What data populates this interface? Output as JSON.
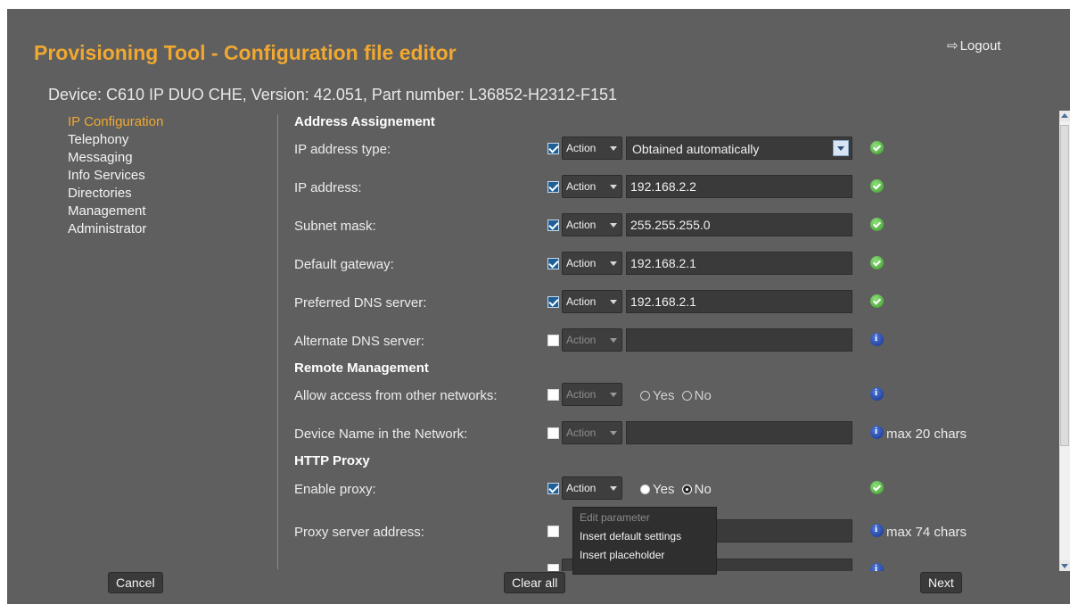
{
  "app": {
    "title": "Provisioning Tool - Configuration file editor",
    "logout_label": "Logout",
    "logout_icon": "arrow-right-icon"
  },
  "device": {
    "model": "Device: C610 IP DUO CHE,",
    "version": "Version: 42.051,",
    "part_number": "Part number: L36852-H2312-F151"
  },
  "nav": {
    "items": [
      {
        "label": "IP Configuration",
        "active": true
      },
      {
        "label": "Telephony",
        "active": false
      },
      {
        "label": "Messaging",
        "active": false
      },
      {
        "label": "Info Services",
        "active": false
      },
      {
        "label": "Directories",
        "active": false
      },
      {
        "label": "Management",
        "active": false
      },
      {
        "label": "Administrator",
        "active": false
      }
    ]
  },
  "sections": {
    "address": "Address Assignement",
    "remote": "Remote Management",
    "proxy": "HTTP Proxy"
  },
  "action_label": "Action",
  "rows": {
    "ip_type": {
      "label": "IP address type:",
      "value": "Obtained automatically",
      "checked": true,
      "status": "ok"
    },
    "ip_address": {
      "label": "IP address:",
      "value": "192.168.2.2",
      "checked": true,
      "status": "ok"
    },
    "subnet": {
      "label": "Subnet mask:",
      "value": "255.255.255.0",
      "checked": true,
      "status": "ok"
    },
    "gateway": {
      "label": "Default gateway:",
      "value": "192.168.2.1",
      "checked": true,
      "status": "ok"
    },
    "dns_pref": {
      "label": "Preferred DNS server:",
      "value": "192.168.2.1",
      "checked": true,
      "status": "ok"
    },
    "dns_alt": {
      "label": "Alternate DNS server:",
      "value": "",
      "checked": false,
      "status": "info"
    },
    "allow_access": {
      "label": "Allow access from other networks:",
      "checked": false,
      "status": "info",
      "yes": "Yes",
      "no": "No",
      "selected": "none"
    },
    "device_name": {
      "label": "Device Name in the Network:",
      "value": "",
      "checked": false,
      "status": "info",
      "hint": "max 20 chars"
    },
    "enable_proxy": {
      "label": "Enable proxy:",
      "checked": true,
      "status": "ok",
      "yes": "Yes",
      "no": "No",
      "selected": "No"
    },
    "proxy_address": {
      "label": "Proxy server address:",
      "value": "",
      "checked": false,
      "status": "info",
      "hint": "max 74 chars"
    }
  },
  "action_menu": {
    "items": [
      {
        "label": "Edit parameter",
        "enabled": false
      },
      {
        "label": "Insert default settings",
        "enabled": true
      },
      {
        "label": "Insert placeholder",
        "enabled": true
      }
    ]
  },
  "footer": {
    "cancel": "Cancel",
    "clear_all": "Clear all",
    "next": "Next"
  },
  "colors": {
    "background": "#5f5f5f",
    "title": "#f0a830",
    "active_nav": "#f0a830",
    "ok_status": "#3a9a2a",
    "info_status": "#14308c"
  }
}
